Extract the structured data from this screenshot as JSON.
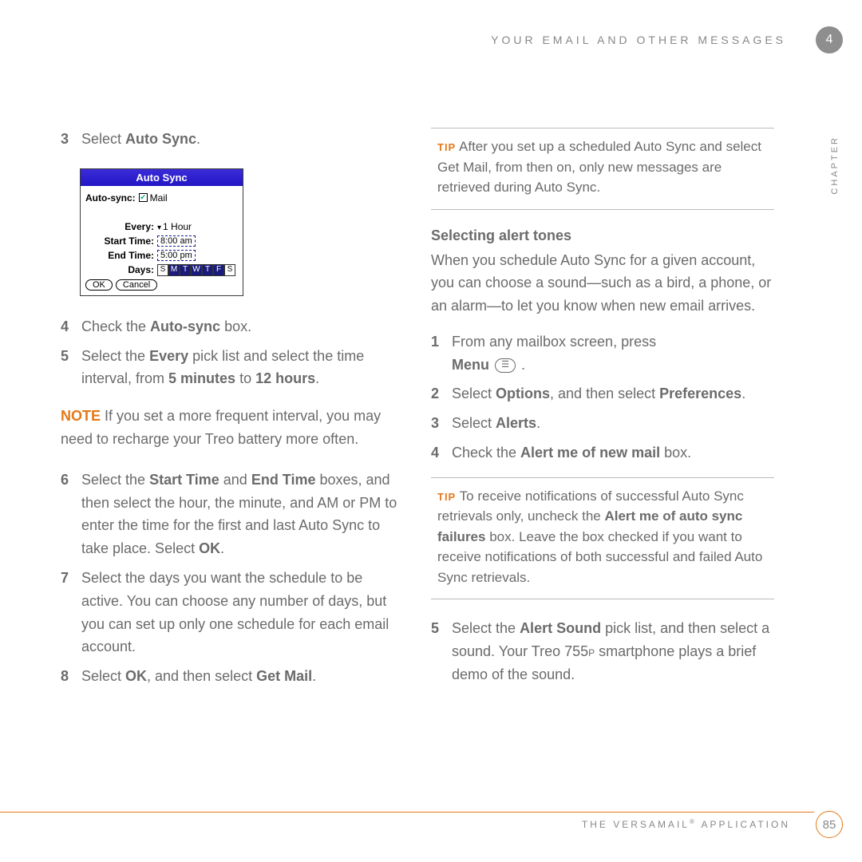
{
  "header": {
    "title": "YOUR EMAIL AND OTHER MESSAGES",
    "chapter_num": "4",
    "chapter_label": "CHAPTER"
  },
  "left": {
    "step3": {
      "num": "3",
      "a": "Select ",
      "b": "Auto Sync",
      "c": "."
    },
    "palm": {
      "title": "Auto Sync",
      "autosync_label": "Auto-sync:",
      "autosync_value": "Mail",
      "every_label": "Every:",
      "every_value": "1 Hour",
      "start_label": "Start Time:",
      "start_value": "8:00 am",
      "end_label": "End Time:",
      "end_value": "5:00 pm",
      "days_label": "Days:",
      "days": [
        "S",
        "M",
        "T",
        "W",
        "T",
        "F",
        "S"
      ],
      "ok": "OK",
      "cancel": "Cancel"
    },
    "step4": {
      "num": "4",
      "a": "Check the ",
      "b": "Auto-sync",
      "c": " box."
    },
    "step5": {
      "num": "5",
      "a": "Select the ",
      "b": "Every",
      "c": " pick list and select the time interval, from ",
      "d": "5 minutes",
      "e": " to ",
      "f": "12 hours",
      "g": "."
    },
    "note": {
      "label": "NOTE",
      "text": "  If you set a more frequent interval, you may need to recharge your Treo battery more often."
    },
    "step6": {
      "num": "6",
      "a": "Select the ",
      "b": "Start Time",
      "c": " and ",
      "d": "End Time",
      "e": " boxes, and then select the hour, the minute, and AM or PM to enter the time for the first and last Auto Sync to take place. Select ",
      "f": "OK",
      "g": "."
    },
    "step7": {
      "num": "7",
      "a": "Select the days you want the schedule to be active. You can choose any number of days, but you can set up only one schedule for each email account."
    },
    "step8": {
      "num": "8",
      "a": "Select ",
      "b": "OK",
      "c": ", and then select ",
      "d": "Get Mail",
      "e": "."
    }
  },
  "right": {
    "tip1": {
      "label": "TIP",
      "text": "  After you set up a scheduled Auto Sync and select Get Mail, from then on, only new messages are retrieved during Auto Sync."
    },
    "section_title": "Selecting alert tones",
    "intro": "When you schedule Auto Sync for a given account, you can choose a sound—such as a bird, a phone, or an alarm—to let you know when new email arrives.",
    "r1": {
      "num": "1",
      "a": "From any mailbox screen, press ",
      "b": "Menu",
      "c": " ."
    },
    "r2": {
      "num": "2",
      "a": "Select ",
      "b": "Options",
      "c": ", and then select ",
      "d": "Preferences",
      "e": "."
    },
    "r3": {
      "num": "3",
      "a": "Select ",
      "b": "Alerts",
      "c": "."
    },
    "r4": {
      "num": "4",
      "a": "Check the ",
      "b": "Alert me of new mail",
      "c": " box."
    },
    "tip2": {
      "label": "TIP",
      "a": "  To receive notifications of successful Auto Sync retrievals only, uncheck the ",
      "b": "Alert me of auto sync failures",
      "c": " box. Leave the box checked if you want to receive notifications of both successful and failed Auto Sync retrievals."
    },
    "r5": {
      "num": "5",
      "a": "Select the ",
      "b": "Alert Sound",
      "c": " pick list, and then select a sound. Your Treo 755",
      "d": "P",
      "e": " smartphone plays a brief demo of the sound."
    }
  },
  "footer": {
    "app": "THE VERSAMAIL",
    "reg": "®",
    "app2": " APPLICATION",
    "page": "85"
  }
}
